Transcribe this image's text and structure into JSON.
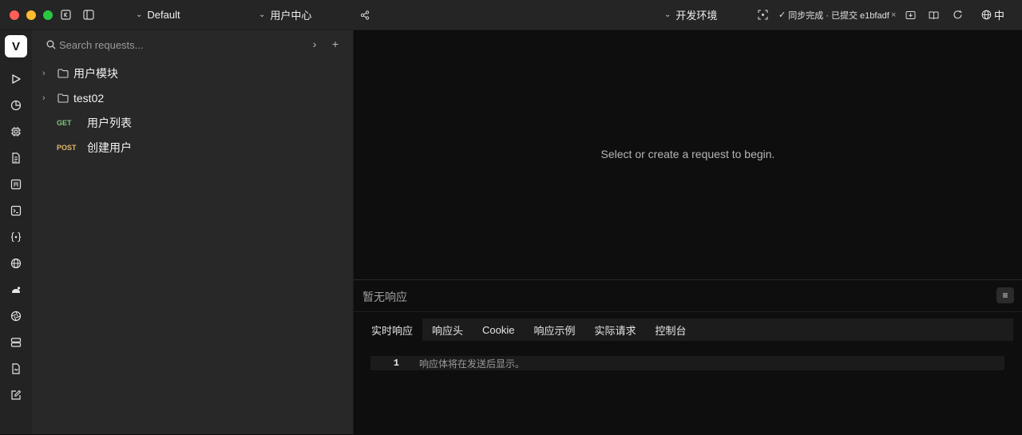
{
  "titlebar": {
    "workspace": "Default",
    "project": "用户中心",
    "environment": "开发环境",
    "sync_status": "同步完成 · 已提交 e1bfadf",
    "language": "中"
  },
  "activity": {
    "logo": "V",
    "icons": [
      "play-icon",
      "history-icon",
      "chip-icon",
      "document-icon",
      "board-icon",
      "terminal-icon",
      "braces-icon",
      "globe-icon",
      "mouse-icon",
      "aperture-icon",
      "server-icon",
      "file-icon",
      "edit-icon"
    ]
  },
  "sidebar": {
    "search_placeholder": "Search requests...",
    "items": [
      {
        "type": "folder",
        "label": "用户模块"
      },
      {
        "type": "folder",
        "label": "test02"
      },
      {
        "type": "request",
        "method": "GET",
        "label": "用户列表"
      },
      {
        "type": "request",
        "method": "POST",
        "label": "创建用户"
      }
    ]
  },
  "main": {
    "empty_message": "Select or create a request to begin."
  },
  "response": {
    "title": "暂无响应",
    "tabs": [
      "实时响应",
      "响应头",
      "Cookie",
      "响应示例",
      "实际请求",
      "控制台"
    ],
    "active_tab": "实时响应",
    "line_number": "1",
    "body_placeholder": "响应体将在发送后显示。"
  },
  "colors": {
    "get_method": "#7ec77e",
    "post_method": "#e3b86a"
  }
}
